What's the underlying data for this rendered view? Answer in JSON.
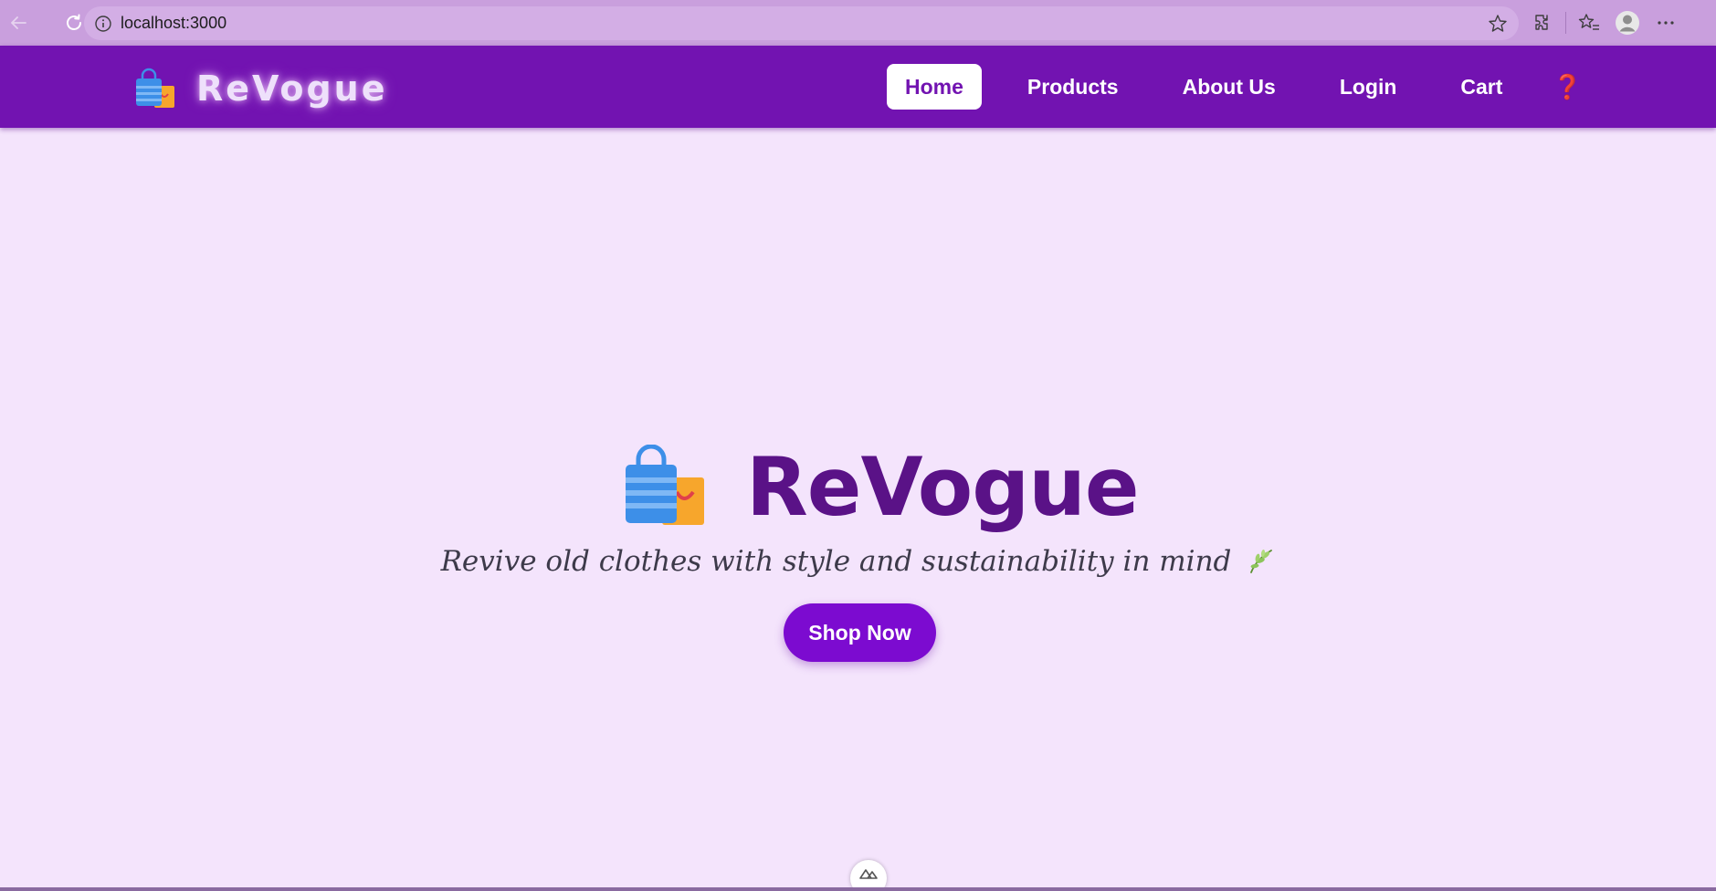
{
  "browser": {
    "url": "localhost:3000",
    "icons": [
      "back-arrow-icon",
      "reload-icon",
      "info-icon",
      "star-icon",
      "extensions-icon",
      "favorites-icon",
      "profile-icon",
      "more-icon"
    ]
  },
  "navbar": {
    "brand": "ReVogue",
    "brand_icon": "shopping-bags-icon",
    "links": [
      {
        "label": "Home",
        "active": true
      },
      {
        "label": "Products",
        "active": false
      },
      {
        "label": "About Us",
        "active": false
      },
      {
        "label": "Login",
        "active": false
      },
      {
        "label": "Cart",
        "active": false
      }
    ],
    "help_icon": "❓"
  },
  "hero": {
    "title": "ReVogue",
    "title_icon": "shopping-bags-icon",
    "subtitle": "Revive old clothes with style and sustainability in mind",
    "subtitle_icon": "leaf-icon",
    "cta": "Shop Now"
  },
  "colors": {
    "navbar": "#7213b1",
    "page_background": "#f4e4fc",
    "hero_title": "#5a1287",
    "cta_background": "#7c0bd0",
    "browser_chrome": "#c99fdd"
  }
}
